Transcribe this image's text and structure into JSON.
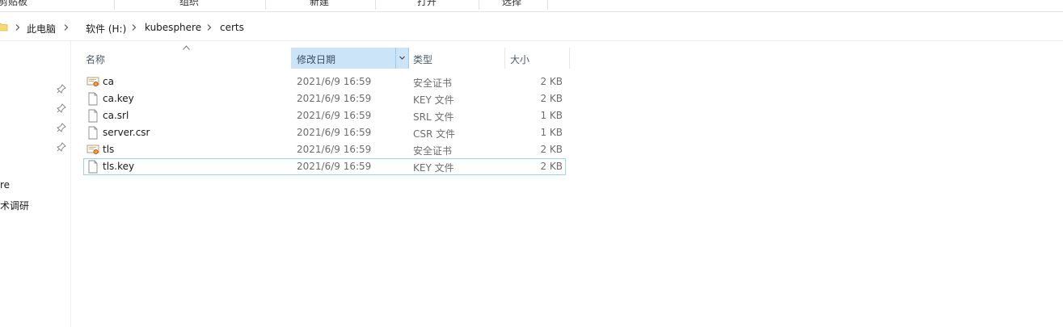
{
  "ribbon": {
    "groups": [
      "剪贴板",
      "组织",
      "新建",
      "打开",
      "选择"
    ]
  },
  "address": {
    "root": "此电脑",
    "drive": "软件 (H:)",
    "folder1": "kubesphere",
    "folder2": "certs"
  },
  "nav": {
    "item1": "re",
    "item2": "术调研"
  },
  "columns": {
    "name": "名称",
    "date": "修改日期",
    "type": "类型",
    "size": "大小"
  },
  "files": [
    {
      "name": "ca",
      "date": "2021/6/9 16:59",
      "type": "安全证书",
      "size": "2 KB",
      "icon": "certificate-icon"
    },
    {
      "name": "ca.key",
      "date": "2021/6/9 16:59",
      "type": "KEY 文件",
      "size": "2 KB",
      "icon": "file-icon"
    },
    {
      "name": "ca.srl",
      "date": "2021/6/9 16:59",
      "type": "SRL 文件",
      "size": "1 KB",
      "icon": "file-icon"
    },
    {
      "name": "server.csr",
      "date": "2021/6/9 16:59",
      "type": "CSR 文件",
      "size": "1 KB",
      "icon": "file-icon"
    },
    {
      "name": "tls",
      "date": "2021/6/9 16:59",
      "type": "安全证书",
      "size": "2 KB",
      "icon": "certificate-icon"
    },
    {
      "name": "tls.key",
      "date": "2021/6/9 16:59",
      "type": "KEY 文件",
      "size": "2 KB",
      "icon": "file-icon"
    }
  ],
  "colors": {
    "header_selected": "#cce4f7",
    "focus_border": "#99d1ff",
    "secondary_text": "#6d6d6d"
  }
}
